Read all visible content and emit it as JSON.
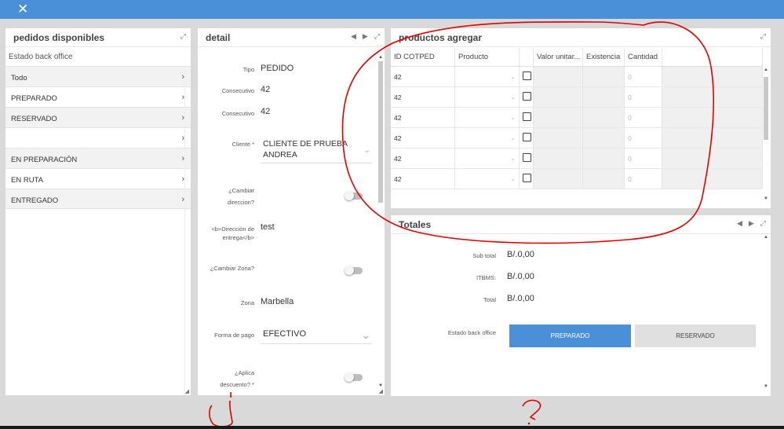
{
  "topbar": {
    "close_icon": "close-icon",
    "color": "#4a90d9"
  },
  "left_panel": {
    "title": "pedidos disponibles",
    "estado_label": "Estado back office",
    "items": [
      {
        "label": "Todo"
      },
      {
        "label": "PREPARADO"
      },
      {
        "label": "RESERVADO"
      },
      {
        "label": ""
      },
      {
        "label": "EN PREPARACIÓN"
      },
      {
        "label": "EN RUTA"
      },
      {
        "label": "ENTREGADO"
      }
    ]
  },
  "detail_panel": {
    "title": "detail",
    "fields": {
      "tipo": {
        "label": "Tipo",
        "value": "PEDIDO"
      },
      "consecutivo1": {
        "label": "Consecutivo",
        "value": "42"
      },
      "consecutivo2": {
        "label": "Consecutivo",
        "value": "42"
      },
      "cliente": {
        "label": "Cliente *",
        "value_line1": "CLIENTE DE PRUEBA",
        "value_line2": "ANDREA"
      },
      "cambiar_direccion": {
        "label_line1": "¿Cambiar",
        "label_line2": "direccion?",
        "on": false
      },
      "direccion": {
        "label_line1": "<b>Dirección de",
        "label_line2": "entrega</b>",
        "value": "test"
      },
      "cambiar_zona": {
        "label": "¿Cambiar Zona?",
        "on": false
      },
      "zona": {
        "label": "Zona",
        "value": "Marbella"
      },
      "forma_pago": {
        "label": "Forma de pago",
        "value": "EFECTIVO"
      },
      "aplica_descuento": {
        "label_line1": "¿Aplica",
        "label_line2": "descuento? *",
        "on": false
      }
    }
  },
  "productos_panel": {
    "title": "productos agregar",
    "columns": [
      "ID COTPED",
      "Producto",
      "",
      "Valor unitar...",
      "Existencia",
      "Cantidad"
    ],
    "rows": [
      {
        "id": "42",
        "cantidad": "0"
      },
      {
        "id": "42",
        "cantidad": "0"
      },
      {
        "id": "42",
        "cantidad": "0"
      },
      {
        "id": "42",
        "cantidad": "0"
      },
      {
        "id": "42",
        "cantidad": "0"
      },
      {
        "id": "42",
        "cantidad": "0"
      }
    ]
  },
  "totales_panel": {
    "title": "Totales",
    "subtotal": {
      "label": "Sub total",
      "value": "B/.0,00"
    },
    "itbms": {
      "label": "ITBMS:",
      "value": "B/.0,00"
    },
    "total": {
      "label": "Total",
      "value": "B/.0,00"
    },
    "estado_label": "Estado back office",
    "btn_preparado": "PREPARADO",
    "btn_reservado": "RESERVADO"
  },
  "colors": {
    "accent": "#4a90d9",
    "annotation": "#e00000"
  }
}
